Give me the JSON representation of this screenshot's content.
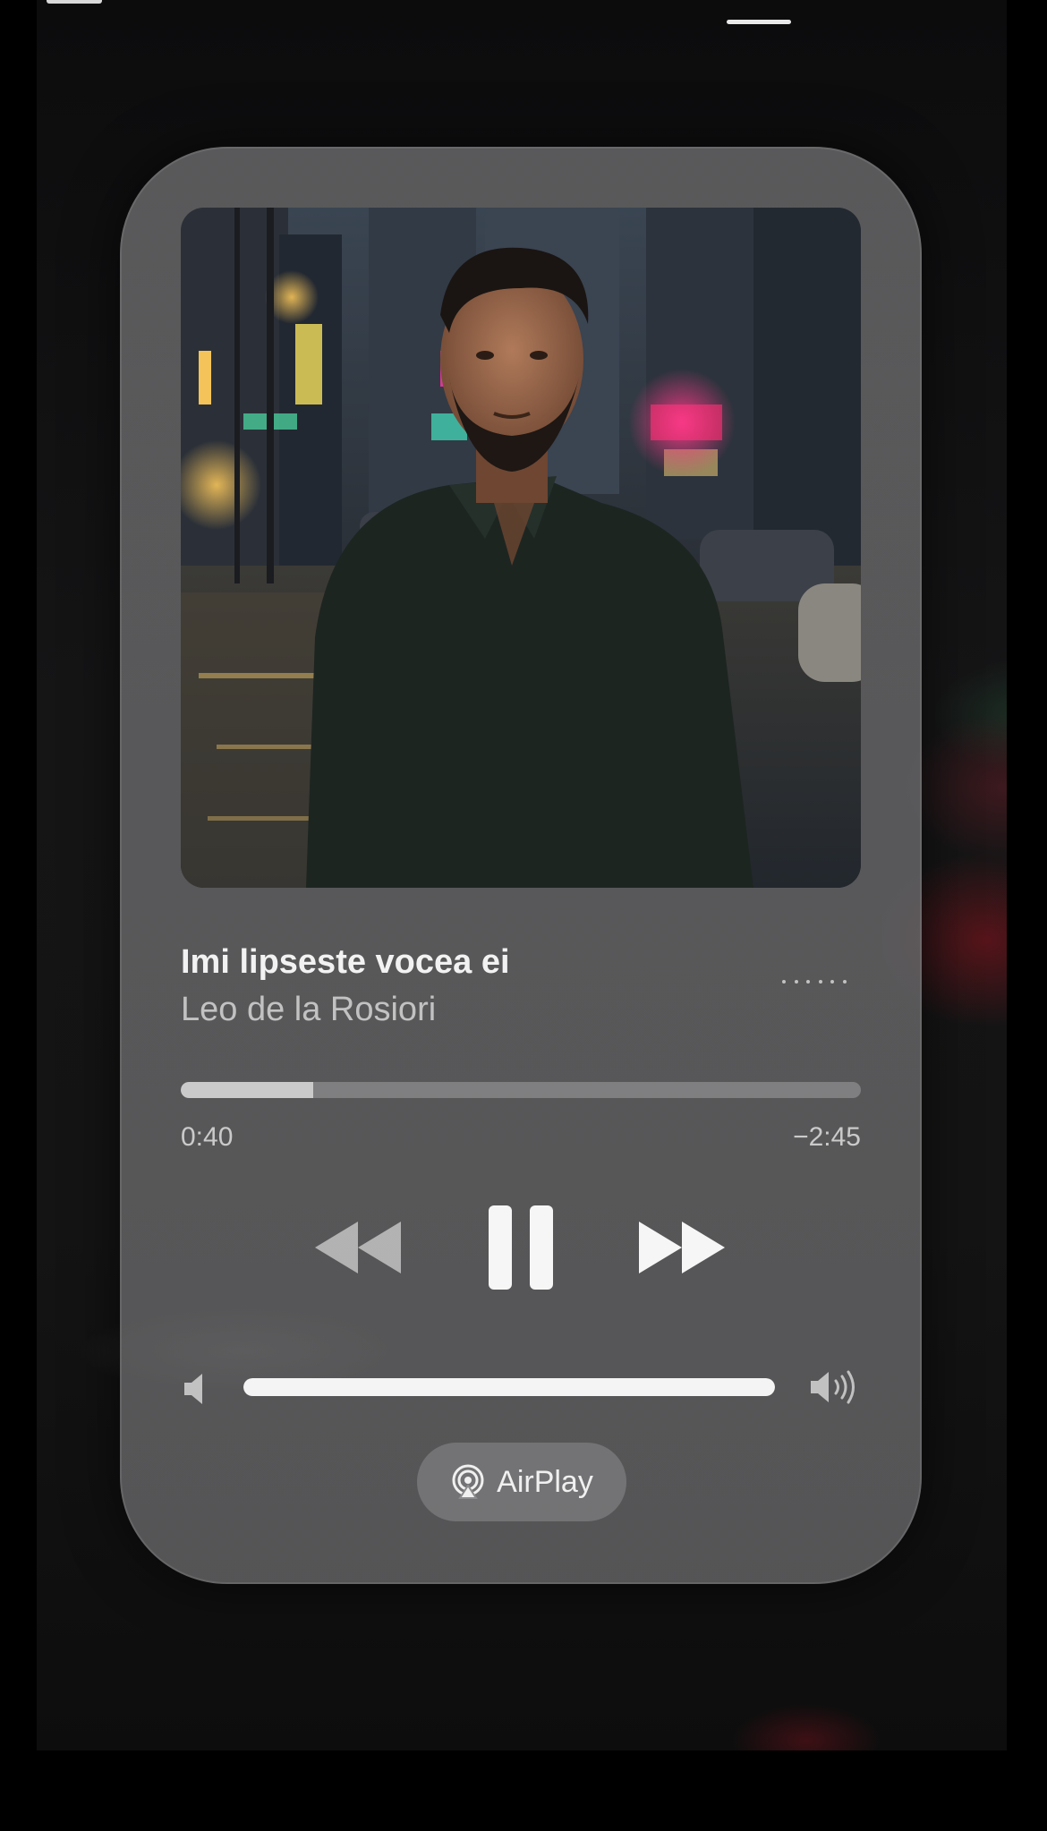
{
  "now_playing": {
    "title": "Imi lipseste vocea ei",
    "artist": "Leo de la Rosiori",
    "elapsed": "0:40",
    "remaining": "−2:45",
    "progress_fraction": 0.195,
    "volume_fraction": 1.0,
    "is_playing": true
  },
  "controls": {
    "rewind_icon": "backward-icon",
    "pause_icon": "pause-icon",
    "forward_icon": "forward-icon",
    "more_icon": "more-dots-icon"
  },
  "output": {
    "airplay_label": "AirPlay",
    "airplay_icon": "airplay-icon"
  },
  "colors": {
    "card_bg": "#6c6c6e",
    "text_primary": "#f2f2f2",
    "text_secondary": "#bdbdbd",
    "progress_fill": "#d7d7d7",
    "volume_fill": "#f4f4f4"
  }
}
